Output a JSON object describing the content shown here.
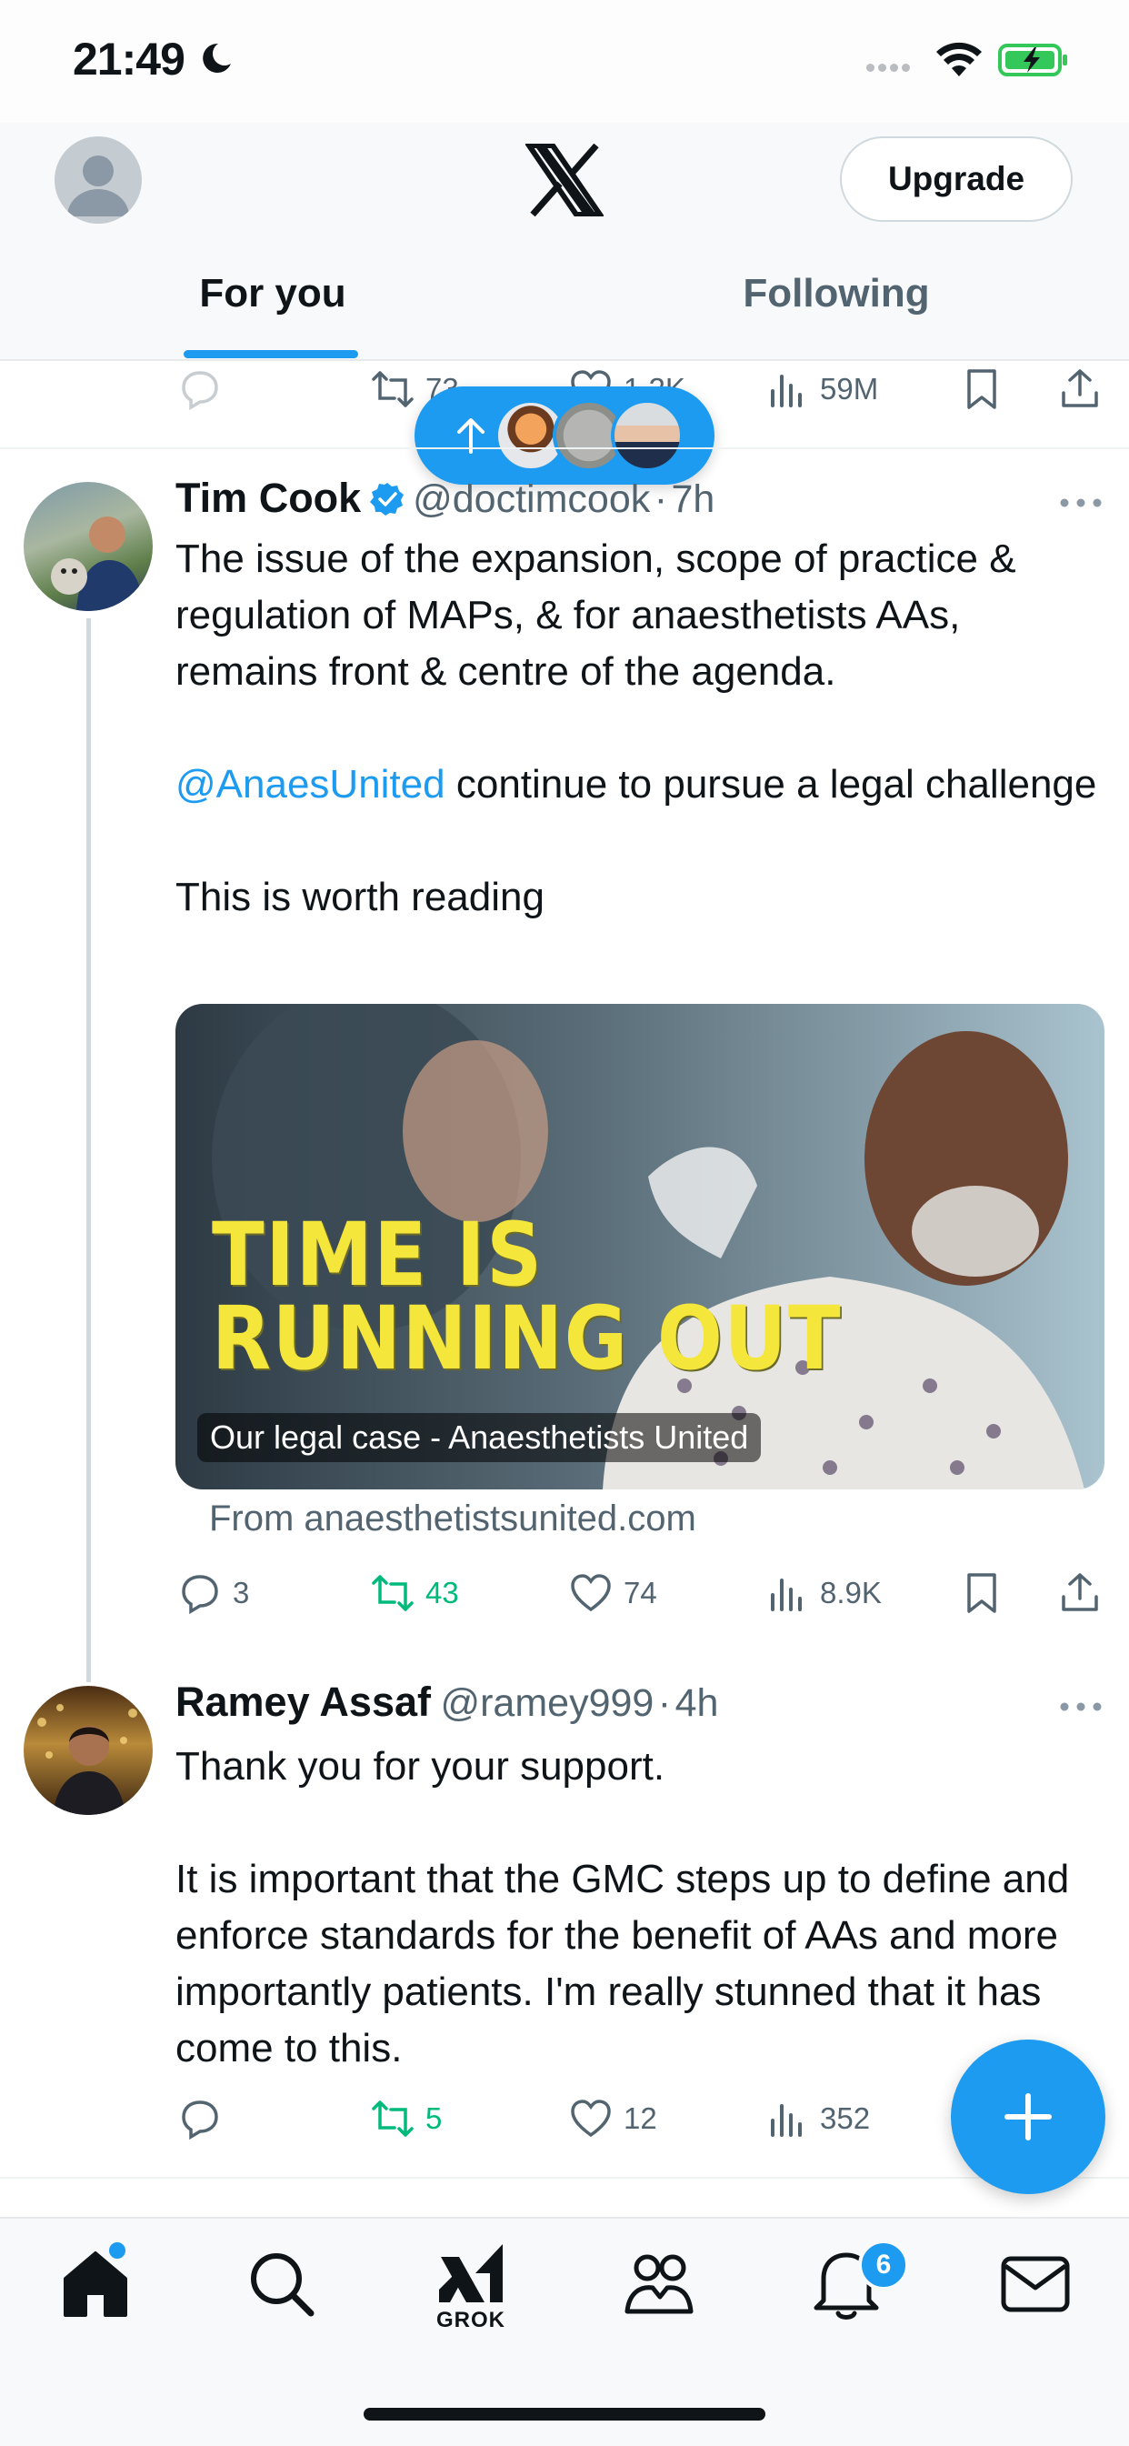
{
  "status_bar": {
    "time": "21:49"
  },
  "header": {
    "upgrade_label": "Upgrade",
    "tabs": [
      {
        "label": "For you",
        "selected": true
      },
      {
        "label": "Following",
        "selected": false
      }
    ]
  },
  "previous_tweet_actions": {
    "retweets": "73",
    "likes": "1.2K",
    "views": "59M"
  },
  "tweets": [
    {
      "name": "Tim Cook",
      "verified": true,
      "handle": "@doctimcook",
      "separator": "·",
      "time": "7h",
      "text_part1": "The issue of the expansion, scope of practice & regulation of MAPs, & for anaesthetists AAs, remains front & centre of the agenda.",
      "mention": "@AnaesUnited",
      "text_part2": " continue to pursue a legal challenge",
      "text_part3": "This is worth reading",
      "card": {
        "headline_line1": "TIME IS",
        "headline_line2": "RUNNING OUT",
        "label": "Our legal case - Anaesthetists United",
        "source": "From anaesthetistsunited.com"
      },
      "replies": "3",
      "retweets": "43",
      "likes": "74",
      "views": "8.9K"
    },
    {
      "name": "Ramey Assaf",
      "handle": "@ramey999",
      "separator": "·",
      "time": "4h",
      "text_part1": "Thank you for your support.",
      "text_part2": "It is important that the GMC steps up to define and enforce standards for the benefit of AAs and more importantly patients. I'm really stunned that it has come to this.",
      "replies": "",
      "retweets": "5",
      "likes": "12",
      "views": "352"
    }
  ],
  "bottom_nav": {
    "grok_label": "GROK",
    "notifications_count": "6"
  },
  "colors": {
    "accent": "#1d9bf0",
    "retweet": "#00ba7c",
    "muted": "#536471"
  }
}
